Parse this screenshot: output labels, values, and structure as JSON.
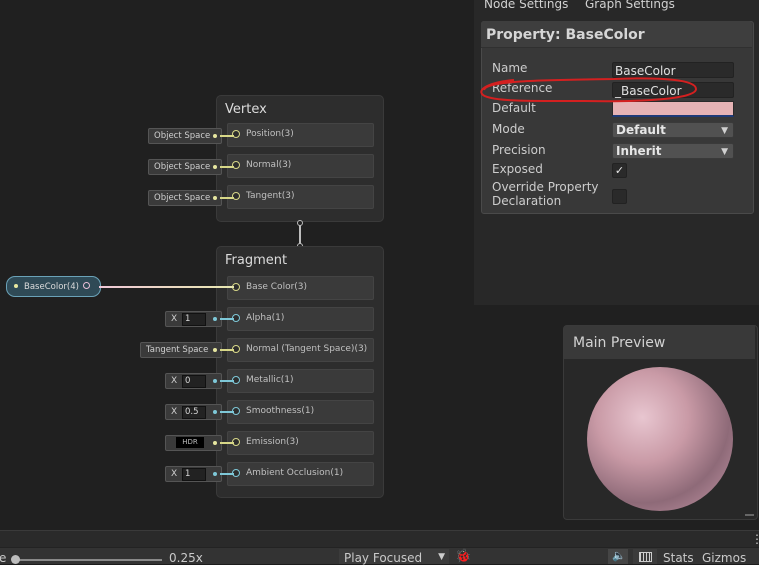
{
  "inspector": {
    "tabs": [
      "Node Settings",
      "Graph Settings"
    ],
    "property_title": "Property: BaseColor",
    "rows": {
      "name": {
        "label": "Name",
        "value": "BaseColor"
      },
      "reference": {
        "label": "Reference",
        "value": "_BaseColor"
      },
      "default": {
        "label": "Default",
        "color": "#e6b3b5"
      },
      "mode": {
        "label": "Mode",
        "value": "Default"
      },
      "precision": {
        "label": "Precision",
        "value": "Inherit"
      },
      "exposed": {
        "label": "Exposed",
        "checked": true,
        "mark": "✓"
      },
      "override": {
        "label_line1": "Override Property",
        "label_line2": "Declaration",
        "checked": false
      }
    },
    "annotation_color": "#d42020"
  },
  "vertex_node": {
    "title": "Vertex",
    "slots": [
      {
        "label": "Position(3)",
        "input": "Object Space"
      },
      {
        "label": "Normal(3)",
        "input": "Object Space"
      },
      {
        "label": "Tangent(3)",
        "input": "Object Space"
      }
    ]
  },
  "fragment_node": {
    "title": "Fragment",
    "slots": [
      {
        "label": "Base Color(3)"
      },
      {
        "label": "Alpha(1)",
        "x_label": "X",
        "x_value": "1"
      },
      {
        "label": "Normal (Tangent Space)(3)",
        "input": "Tangent Space"
      },
      {
        "label": "Metallic(1)",
        "x_label": "X",
        "x_value": "0"
      },
      {
        "label": "Smoothness(1)",
        "x_label": "X",
        "x_value": "0.5"
      },
      {
        "label": "Emission(3)",
        "input": "HDR"
      },
      {
        "label": "Ambient Occlusion(1)",
        "x_label": "X",
        "x_value": "1"
      }
    ]
  },
  "property_node": {
    "label": "BaseColor(4)"
  },
  "preview": {
    "title": "Main Preview",
    "sphere_color": "#c99aa6"
  },
  "toolbar": {
    "scale_prefix": "e",
    "scale_value": "0.25x",
    "play_mode": "Play Focused",
    "stats": "Stats",
    "gizmos": "Gizmos",
    "more_icon": "more-vertical-icon"
  }
}
